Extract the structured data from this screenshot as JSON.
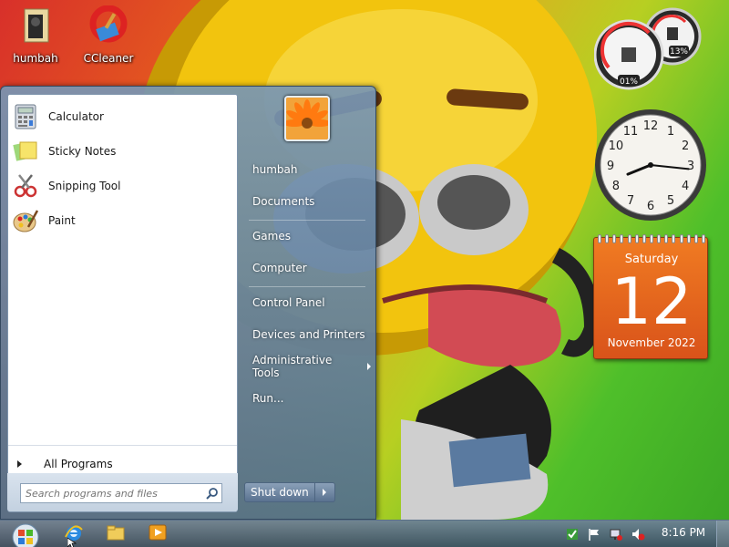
{
  "desktop": {
    "icons": [
      {
        "label": "humbah"
      },
      {
        "label": "CCleaner"
      }
    ]
  },
  "start_menu": {
    "programs": [
      {
        "label": "Calculator"
      },
      {
        "label": "Sticky Notes"
      },
      {
        "label": "Snipping Tool"
      },
      {
        "label": "Paint"
      }
    ],
    "all_programs": "All Programs",
    "search_placeholder": "Search programs and files",
    "right_items": [
      {
        "label": "humbah"
      },
      {
        "label": "Documents"
      },
      {
        "label": "Games"
      },
      {
        "label": "Computer"
      },
      {
        "label": "Control Panel"
      },
      {
        "label": "Devices and Printers"
      },
      {
        "label": "Administrative Tools"
      },
      {
        "label": "Run..."
      }
    ],
    "shutdown_label": "Shut down"
  },
  "gadgets": {
    "cpu_meter": {
      "cpu": "01%",
      "memory": "13%"
    },
    "clock": {
      "hour": 8,
      "minute": 16
    },
    "calendar": {
      "weekday": "Saturday",
      "day": "12",
      "month_year": "November 2022"
    }
  },
  "taskbar": {
    "time": "8:16 PM"
  },
  "colors": {
    "calendar_orange": "#e8641c",
    "start_menu_blue": "#6d88a6"
  }
}
